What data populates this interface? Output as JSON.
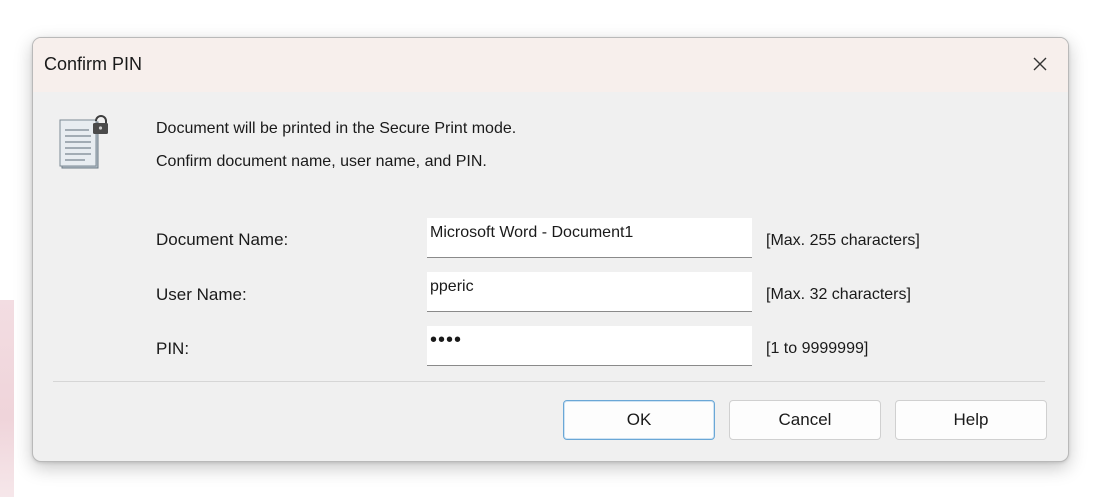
{
  "dialog": {
    "title": "Confirm PIN",
    "close_icon": "close-icon",
    "document_icon": "secure-document-icon",
    "message_line1": "Document will be printed in the Secure Print mode.",
    "message_line2": "Confirm document name, user name, and PIN."
  },
  "fields": {
    "document_name": {
      "label": "Document Name:",
      "value": "Microsoft Word - Document1",
      "hint": "[Max. 255 characters]"
    },
    "user_name": {
      "label": "User Name:",
      "value": "pperic",
      "hint": "[Max. 32 characters]"
    },
    "pin": {
      "label": "PIN:",
      "value_masked": "••••",
      "hint": "[1 to 9999999]"
    }
  },
  "buttons": {
    "ok": "OK",
    "cancel": "Cancel",
    "help": "Help"
  },
  "colors": {
    "dialog_background": "#f0f0f0",
    "titlebar_background": "#f7efec",
    "default_button_border": "#6aa7d6"
  }
}
